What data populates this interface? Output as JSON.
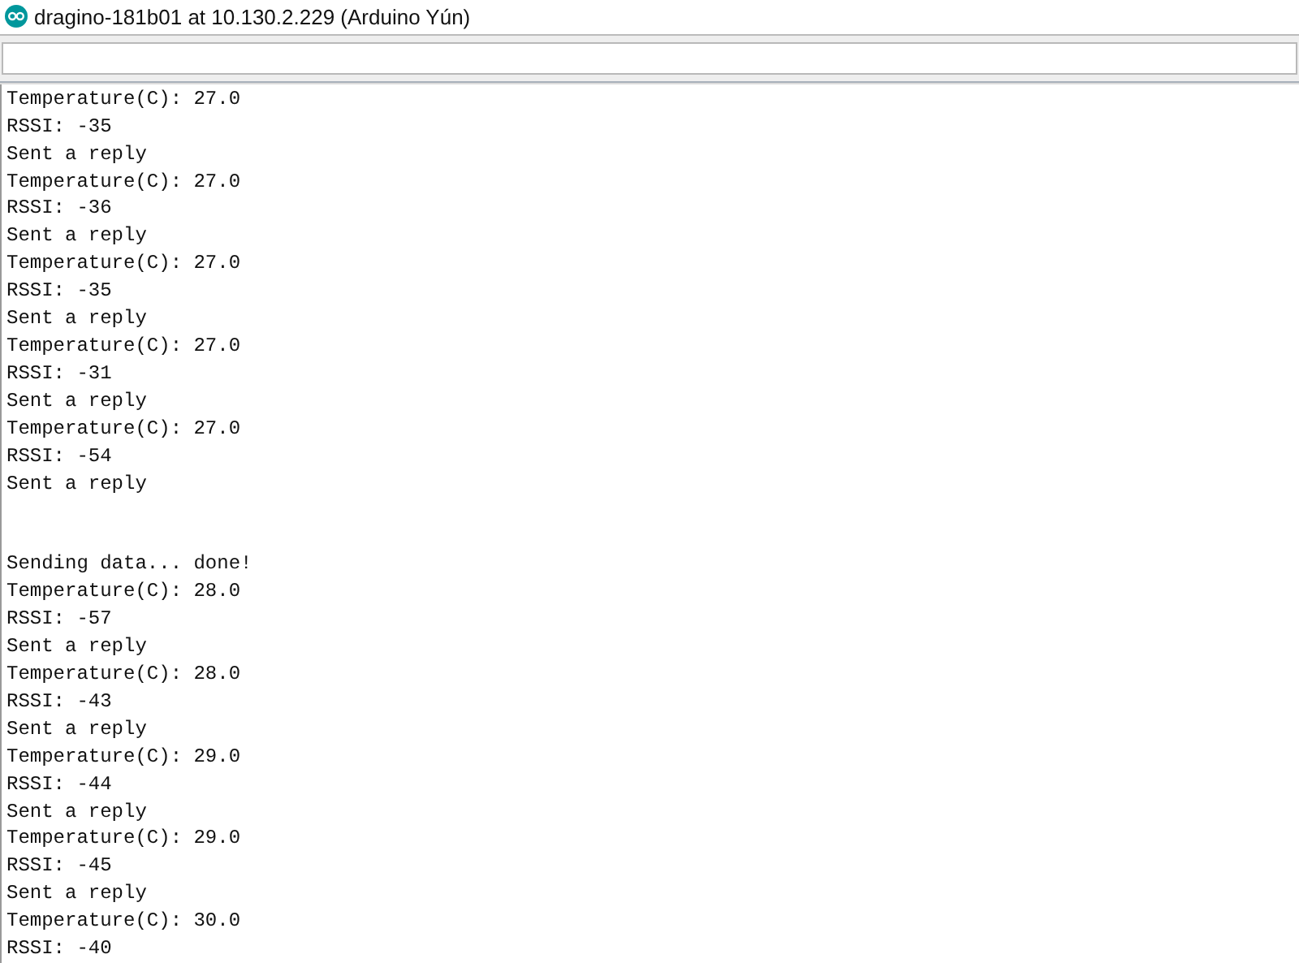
{
  "window": {
    "title": "dragino-181b01 at 10.130.2.229 (Arduino Yún)"
  },
  "output": {
    "blocks": [
      [
        "Temperature(C): 27.0",
        "RSSI: -35",
        "Sent a reply",
        "Temperature(C): 27.0",
        "RSSI: -36",
        "Sent a reply",
        "Temperature(C): 27.0",
        "RSSI: -35",
        "Sent a reply",
        "Temperature(C): 27.0",
        "RSSI: -31",
        "Sent a reply",
        "Temperature(C): 27.0",
        "RSSI: -54",
        "Sent a reply"
      ],
      [
        "Sending data... done!",
        "Temperature(C): 28.0",
        "RSSI: -57",
        "Sent a reply",
        "Temperature(C): 28.0",
        "RSSI: -43",
        "Sent a reply",
        "Temperature(C): 29.0",
        "RSSI: -44",
        "Sent a reply",
        "Temperature(C): 29.0",
        "RSSI: -45",
        "Sent a reply",
        "Temperature(C): 30.0",
        "RSSI: -40"
      ]
    ]
  }
}
